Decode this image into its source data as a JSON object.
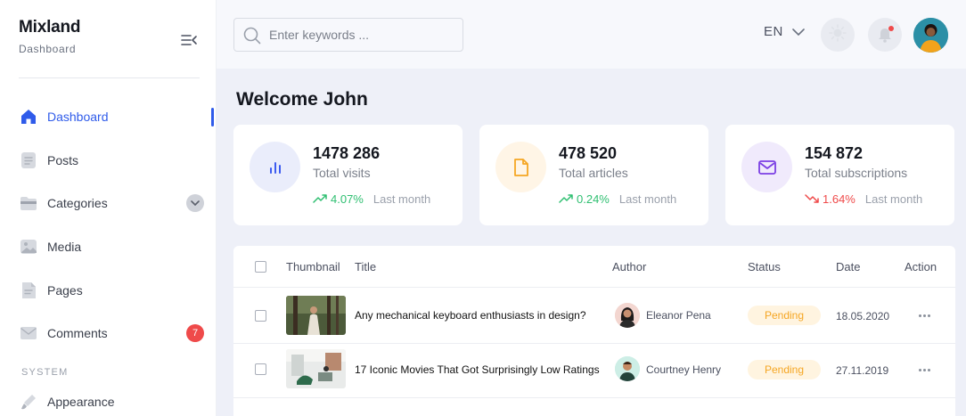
{
  "brand": {
    "name": "Mixland",
    "subtitle": "Dashboard"
  },
  "sidebar": {
    "items": [
      {
        "label": "Dashboard",
        "icon": "home-icon",
        "active": true
      },
      {
        "label": "Posts",
        "icon": "document-icon"
      },
      {
        "label": "Categories",
        "icon": "folder-icon",
        "has_chevron": true
      },
      {
        "label": "Media",
        "icon": "image-icon"
      },
      {
        "label": "Pages",
        "icon": "page-icon"
      },
      {
        "label": "Comments",
        "icon": "mail-icon",
        "badge": "7"
      }
    ],
    "section_label": "SYSTEM",
    "system_items": [
      {
        "label": "Appearance",
        "icon": "brush-icon"
      }
    ]
  },
  "header": {
    "search_placeholder": "Enter keywords ...",
    "language": "EN"
  },
  "main": {
    "welcome": "Welcome John",
    "stats": [
      {
        "value": "1478 286",
        "label": "Total visits",
        "trend": "4.07%",
        "trend_dir": "up",
        "period": "Last month",
        "icon": "bar-chart-icon",
        "icon_color": "#3d5cf0",
        "icon_bg": "#eaedfb",
        "trend_color": "#2fbf71"
      },
      {
        "value": "478 520",
        "label": "Total articles",
        "trend": "0.24%",
        "trend_dir": "up",
        "period": "Last month",
        "icon": "file-icon",
        "icon_color": "#f5a623",
        "icon_bg": "#fff5e6",
        "trend_color": "#2fbf71"
      },
      {
        "value": "154 872",
        "label": "Total subscriptions",
        "trend": "1.64%",
        "trend_dir": "down",
        "period": "Last month",
        "icon": "envelope-icon",
        "icon_color": "#7b3fe4",
        "icon_bg": "#f0eafc",
        "trend_color": "#ef4a4a"
      }
    ],
    "table": {
      "headers": {
        "thumbnail": "Thumbnail",
        "title": "Title",
        "author": "Author",
        "status": "Status",
        "date": "Date",
        "action": "Action"
      },
      "rows": [
        {
          "title": "Any mechanical keyboard enthusiasts in design?",
          "author": "Eleanor Pena",
          "status": "Pending",
          "date": "18.05.2020"
        },
        {
          "title": "17 Iconic Movies That Got Surprisingly Low Ratings",
          "author": "Courtney Henry",
          "status": "Pending",
          "date": "27.11.2019"
        }
      ]
    }
  },
  "colors": {
    "accent": "#2f5bea",
    "badge": "#ef4a4a",
    "pending_bg": "#fff4e0",
    "pending_text": "#f5a623"
  }
}
